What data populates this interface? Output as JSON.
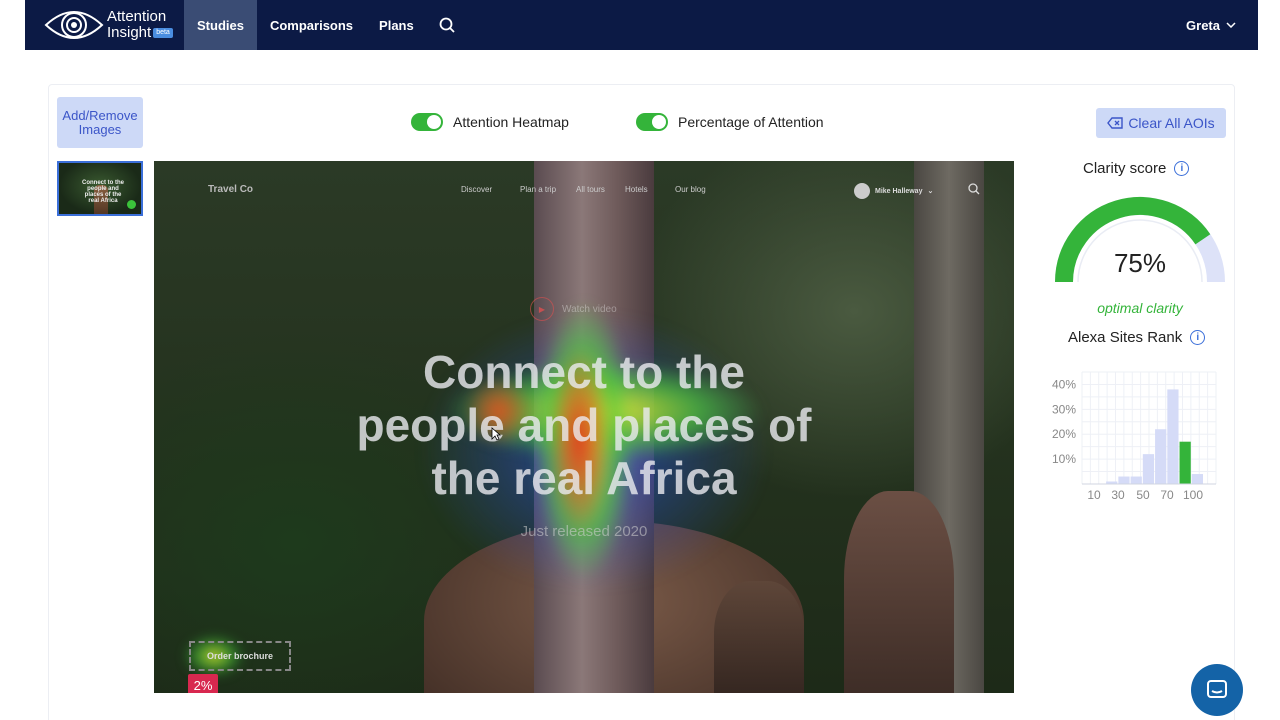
{
  "nav": {
    "brand_line1": "Attention",
    "brand_line2": "Insight",
    "brand_badge": "beta",
    "links": [
      "Studies",
      "Comparisons",
      "Plans"
    ],
    "active": "Studies",
    "user": "Greta"
  },
  "sidebar": {
    "add_remove_label": "Add/Remove Images"
  },
  "thumbnail_caption": "Connect to the people and places of the real Africa",
  "toggles": [
    {
      "label": "Attention Heatmap",
      "on": true
    },
    {
      "label": "Percentage of Attention",
      "on": true
    }
  ],
  "clear_aois_label": "Clear All AOIs",
  "image": {
    "brand": "Travel Co",
    "nav_items": [
      "Discover",
      "Plan a trip",
      "All tours",
      "Hotels",
      "Our blog"
    ],
    "user": "Mike Halleway",
    "watch_video": "Watch video",
    "headline_lines": [
      "Connect to the",
      "people and places of",
      "the real Africa"
    ],
    "subheadline": "Just released 2020",
    "aoi_label": "Order brochure",
    "aoi_percent": "2%"
  },
  "clarity": {
    "title": "Clarity score",
    "value_percent": 75,
    "value_label": "75%",
    "note": "optimal clarity",
    "color": "#34b43a"
  },
  "alexa": {
    "title": "Alexa Sites Rank"
  },
  "chart_data": {
    "type": "bar",
    "title": "Alexa Sites Rank",
    "x_tick_labels": [
      "10",
      "30",
      "50",
      "70",
      "100"
    ],
    "y_tick_labels": [
      "10%",
      "20%",
      "30%",
      "40%"
    ],
    "ylim": [
      0,
      45
    ],
    "bins": [
      1,
      3,
      3,
      12,
      22,
      38,
      17,
      4
    ],
    "highlight_bin": 6,
    "bar_color": "#d5dbf7",
    "highlight_color": "#34b43a",
    "grid": true
  }
}
